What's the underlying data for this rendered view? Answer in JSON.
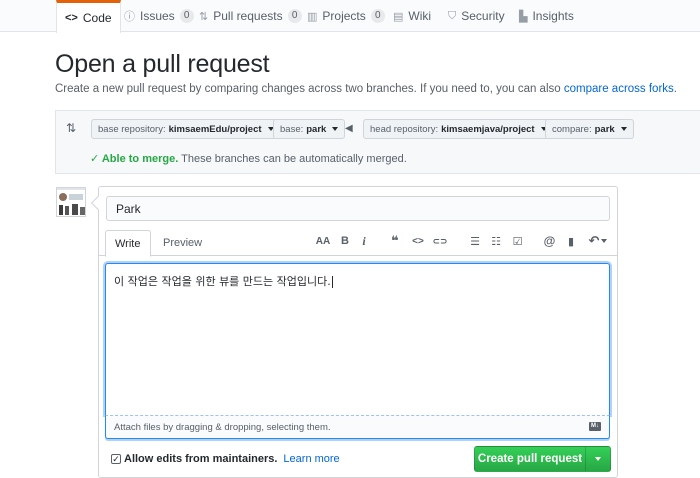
{
  "tabs": [
    {
      "label": "Code",
      "icon": "code-icon"
    },
    {
      "label": "Issues",
      "count": "0",
      "icon": "issue-icon"
    },
    {
      "label": "Pull requests",
      "count": "0",
      "icon": "pull-request-icon"
    },
    {
      "label": "Projects",
      "count": "0",
      "icon": "project-icon"
    },
    {
      "label": "Wiki",
      "icon": "wiki-icon"
    },
    {
      "label": "Security",
      "icon": "shield-icon"
    },
    {
      "label": "Insights",
      "icon": "graph-icon"
    }
  ],
  "page": {
    "title": "Open a pull request",
    "subtitle": "Create a new pull request by comparing changes across two branches. If you need to, you can also ",
    "compare_link": "compare across forks",
    "subtitle_end": "."
  },
  "range": {
    "base_repo_prefix": "base repository: ",
    "base_repo_value": "kimsaemEdu/project",
    "base_prefix": "base: ",
    "base_value": "park",
    "head_repo_prefix": "head repository: ",
    "head_repo_value": "kimsaemjava/project",
    "compare_prefix": "compare: ",
    "compare_value": "park",
    "merge_ok": "✓ Able to merge.",
    "merge_text": " These branches can be automatically merged."
  },
  "form": {
    "title_value": "Park",
    "write_tab": "Write",
    "preview_tab": "Preview",
    "body_text": "이 작업은 작업을 위한 뷰를 만드는 작업입니다.",
    "attach_text": "Attach files by dragging & dropping, selecting them.",
    "allow_edits": "Allow edits from maintainers.",
    "learn_more": "Learn more",
    "create_button": "Create pull request"
  },
  "toolbar": {
    "heading": "AA",
    "bold": "B",
    "italic": "i",
    "quote": "❝",
    "code": "<>",
    "link": "⊂⊃",
    "bulleted": "☰",
    "numbered": "☷",
    "task": "☑",
    "mention": "@",
    "bookmark": "▮",
    "reply": "↶"
  },
  "colors": {
    "accent": "#0366d6",
    "success": "#28a745",
    "tab_active": "#e36209"
  }
}
